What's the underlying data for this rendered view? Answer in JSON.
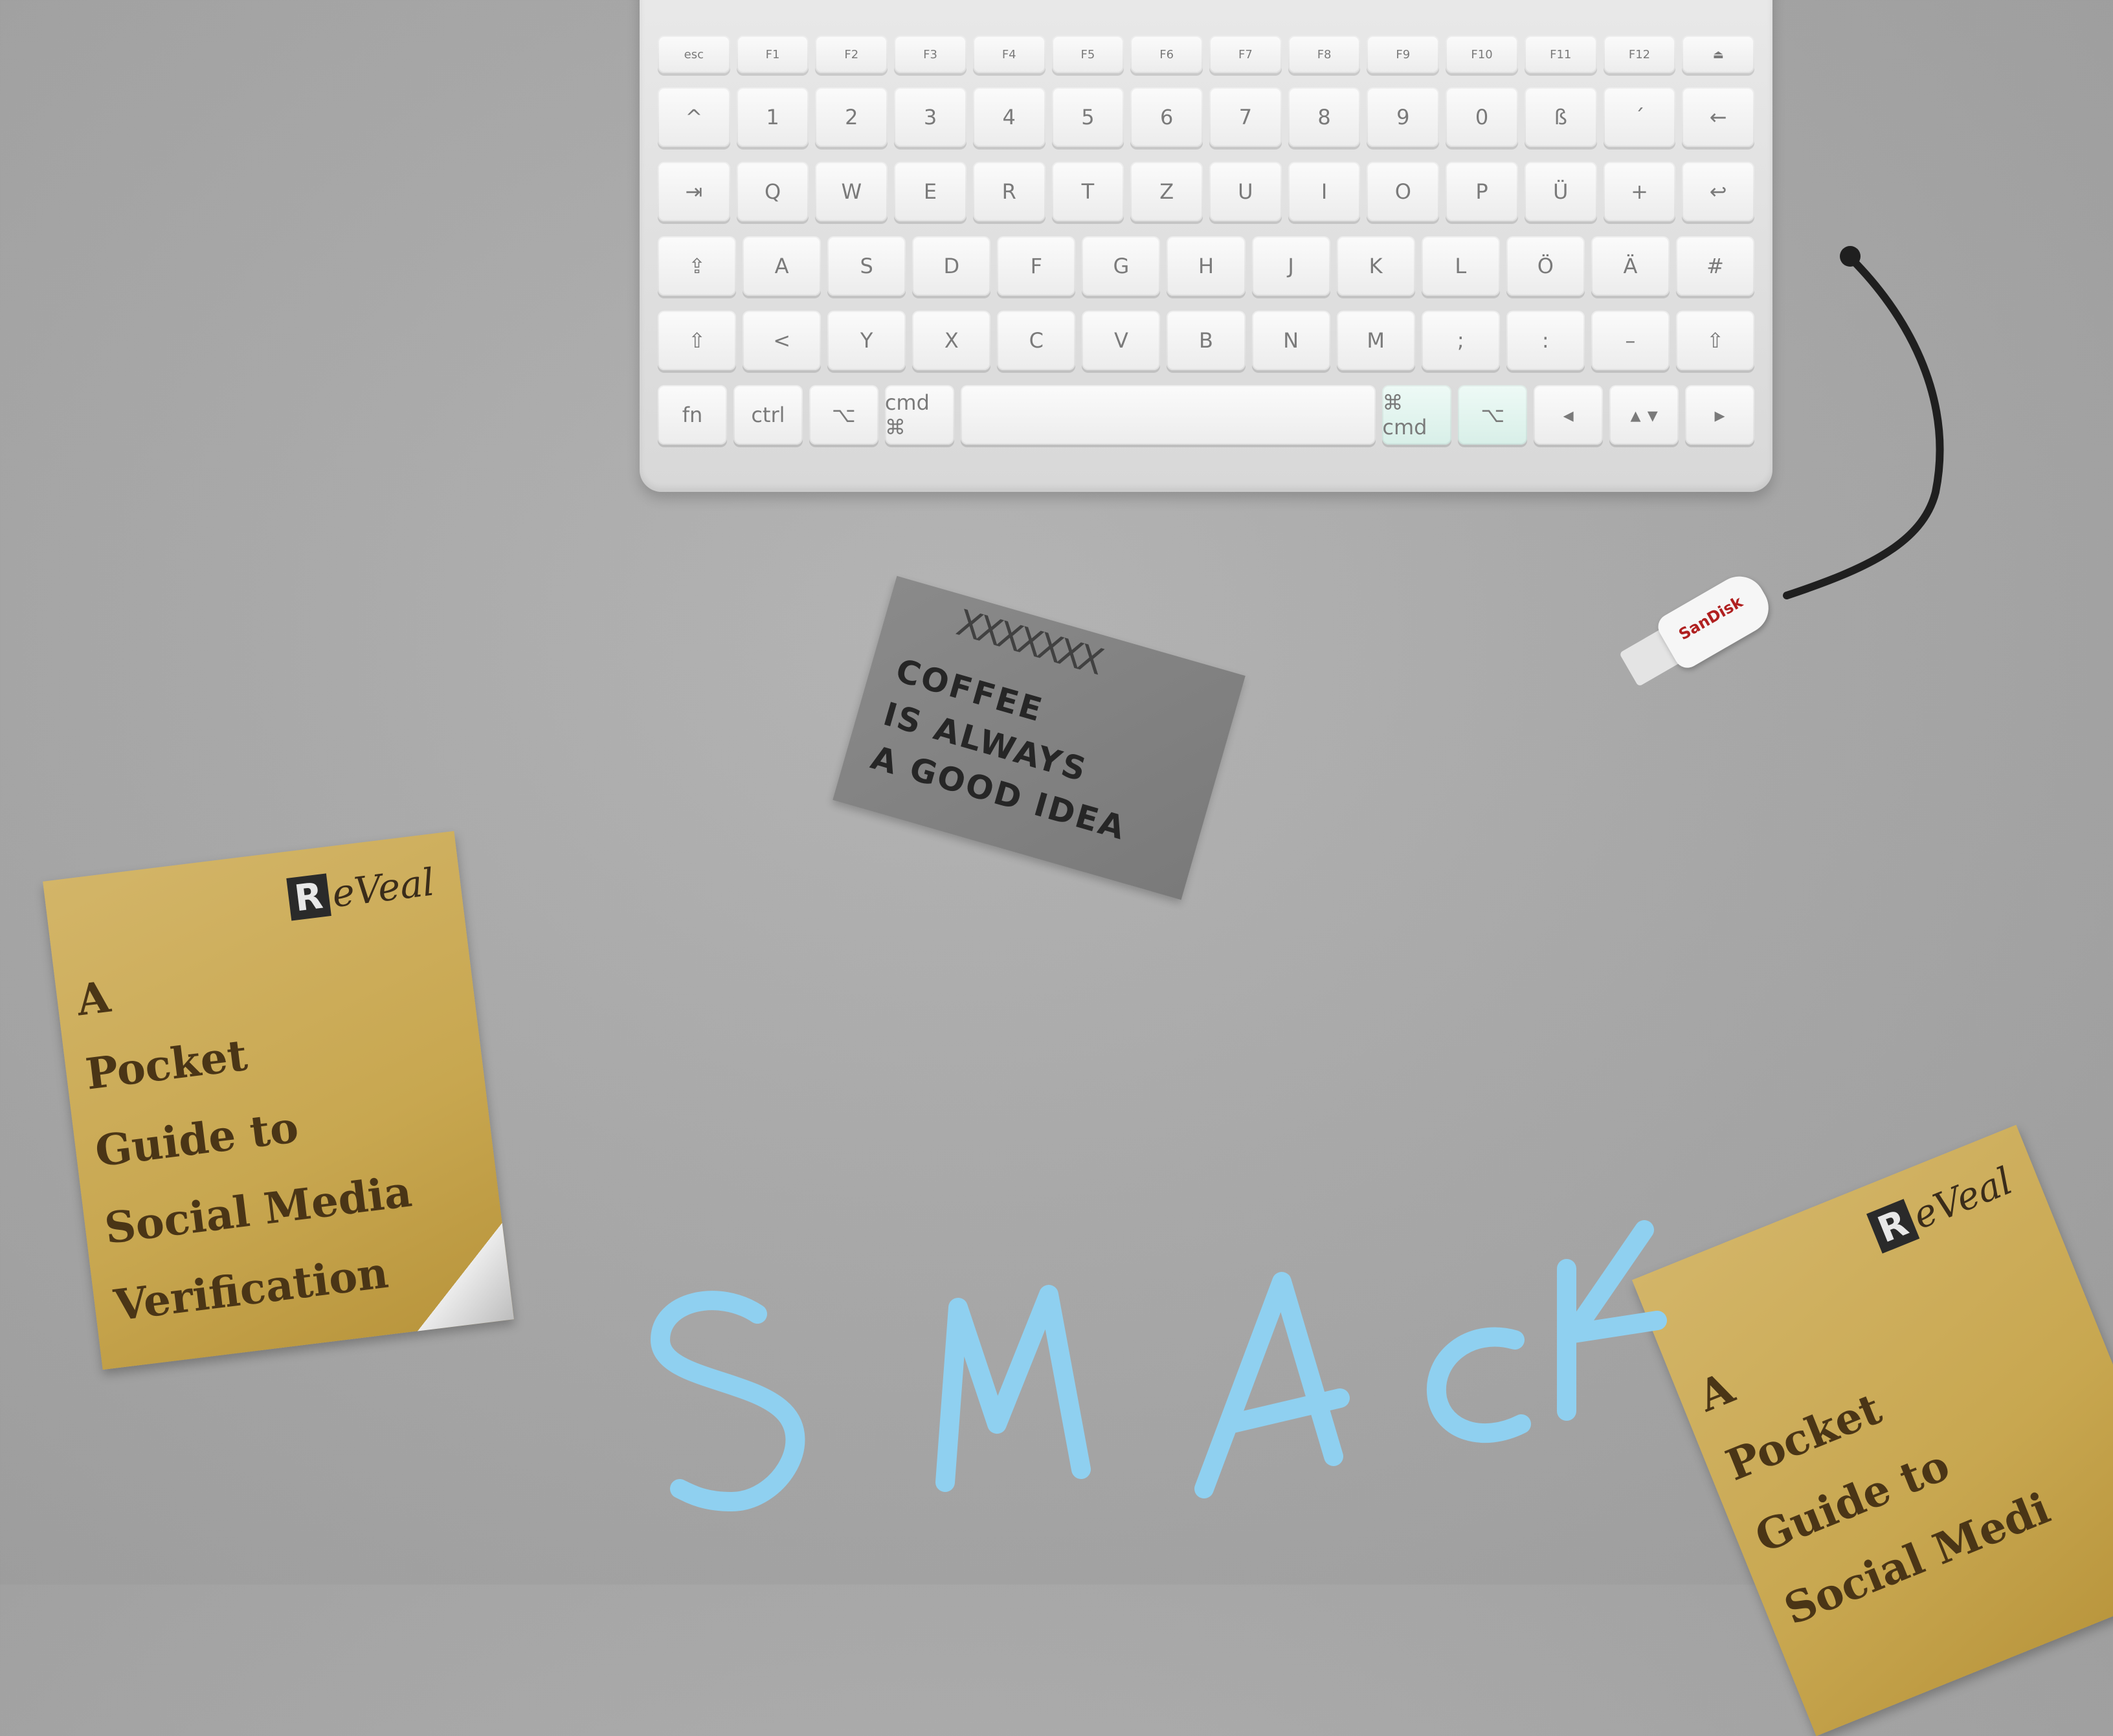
{
  "keyboard": {
    "rows": [
      [
        "esc",
        "F1",
        "F2",
        "F3",
        "F4",
        "F5",
        "F6",
        "F7",
        "F8",
        "F9",
        "F10",
        "F11",
        "F12",
        "⏏"
      ],
      [
        "^",
        "1",
        "2",
        "3",
        "4",
        "5",
        "6",
        "7",
        "8",
        "9",
        "0",
        "ß",
        "´",
        "←"
      ],
      [
        "⇥",
        "Q",
        "W",
        "E",
        "R",
        "T",
        "Z",
        "U",
        "I",
        "O",
        "P",
        "Ü",
        "+",
        "↩"
      ],
      [
        "⇪",
        "A",
        "S",
        "D",
        "F",
        "G",
        "H",
        "J",
        "K",
        "L",
        "Ö",
        "Ä",
        "#"
      ],
      [
        "⇧",
        "<",
        "Y",
        "X",
        "C",
        "V",
        "B",
        "N",
        "M",
        ";",
        ":",
        "–",
        "⇧"
      ],
      [
        "fn",
        "ctrl",
        "⌥",
        "cmd ⌘",
        "",
        "⌘ cmd",
        "⌥",
        "◂",
        "▴ ▾",
        "▸"
      ]
    ]
  },
  "coffee_card": {
    "x_marks": "XXXXXXX",
    "line1": "COFFEE",
    "line2": "IS ALWAYS",
    "line3": "A GOOD IDEA"
  },
  "booklet_left": {
    "logo_r": "R",
    "logo_text": "eVeal",
    "title_lines": [
      "A",
      "Pocket",
      "Guide to",
      "Social Media",
      "Verification"
    ]
  },
  "booklet_right": {
    "logo_r": "R",
    "logo_text": "eVeal",
    "title_lines": [
      "A",
      "Pocket",
      "Guide to",
      "Social Medi"
    ]
  },
  "usb": {
    "brand": "SanDisk"
  },
  "scribble": {
    "text": "SMACK",
    "color": "#8fd0f0"
  }
}
